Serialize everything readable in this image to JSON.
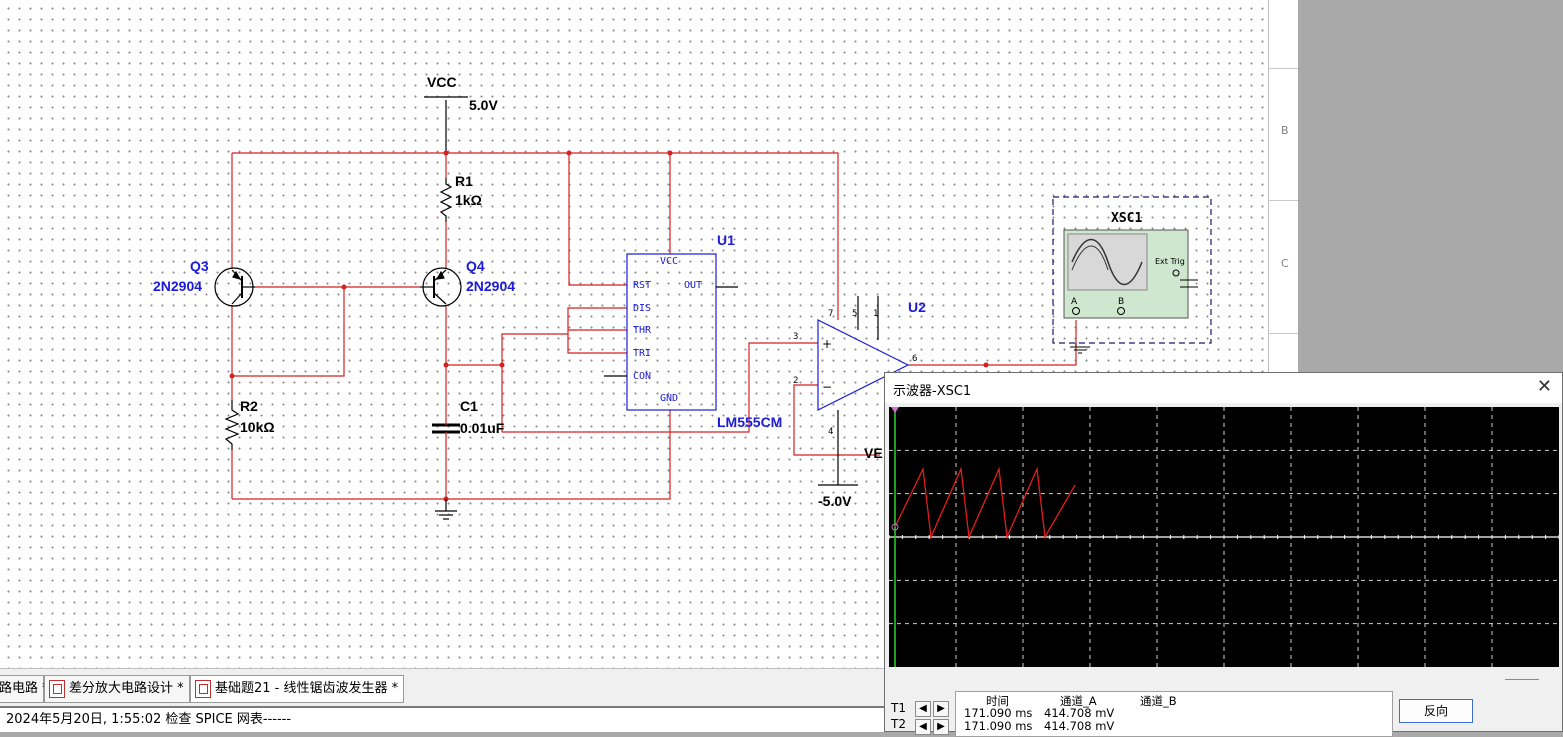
{
  "ruler": {
    "labels": [
      "B",
      "C"
    ]
  },
  "schematic": {
    "vcc": {
      "name": "VCC",
      "value": "5.0V"
    },
    "r1": {
      "name": "R1",
      "value": "1kΩ"
    },
    "r2": {
      "name": "R2",
      "value": "10kΩ"
    },
    "q3": {
      "name": "Q3",
      "part": "2N2904"
    },
    "q4": {
      "name": "Q4",
      "part": "2N2904"
    },
    "c1": {
      "name": "C1",
      "value": "0.01uF"
    },
    "u1": {
      "name": "U1",
      "part": "LM555CM",
      "pins": {
        "vcc": "VCC",
        "rst": "RST",
        "out": "OUT",
        "dis": "DIS",
        "thr": "THR",
        "tri": "TRI",
        "con": "CON",
        "gnd": "GND"
      }
    },
    "u2": {
      "name": "U2",
      "pin_numbers": [
        "7",
        "5",
        "1",
        "3",
        "2",
        "6",
        "4"
      ]
    },
    "vee": {
      "label": "VE",
      "value": "-5.0V"
    },
    "xsc1": {
      "name": "XSC1",
      "ext_trig": "Ext Trig",
      "channel_a": "A",
      "channel_b": "B"
    }
  },
  "tabs": [
    {
      "label": "路电路 *"
    },
    {
      "label": "差分放大电路设计 *"
    },
    {
      "label": "基础题21 - 线性锯齿波发生器 *"
    }
  ],
  "status": {
    "text": "2024年5月20日, 1:55:02 检查 SPICE 网表------"
  },
  "scope": {
    "title": "示波器-XSC1",
    "close": "✕",
    "trace_color": "#e31c1c",
    "grid_color": "#cfcfcf",
    "t1_label": "T1",
    "t2_label": "T2",
    "readout": {
      "headers": [
        "时间",
        "通道_A",
        "通道_B"
      ],
      "rows": [
        [
          "171.090 ms",
          "414.708 mV",
          ""
        ],
        [
          "171.090 ms",
          "414.708 mV",
          ""
        ]
      ]
    },
    "reverse_button": "反向"
  },
  "colors": {
    "wire": "#d42020",
    "component_blue": "#1a1adb",
    "instrument_green": "#cfe6cf"
  }
}
